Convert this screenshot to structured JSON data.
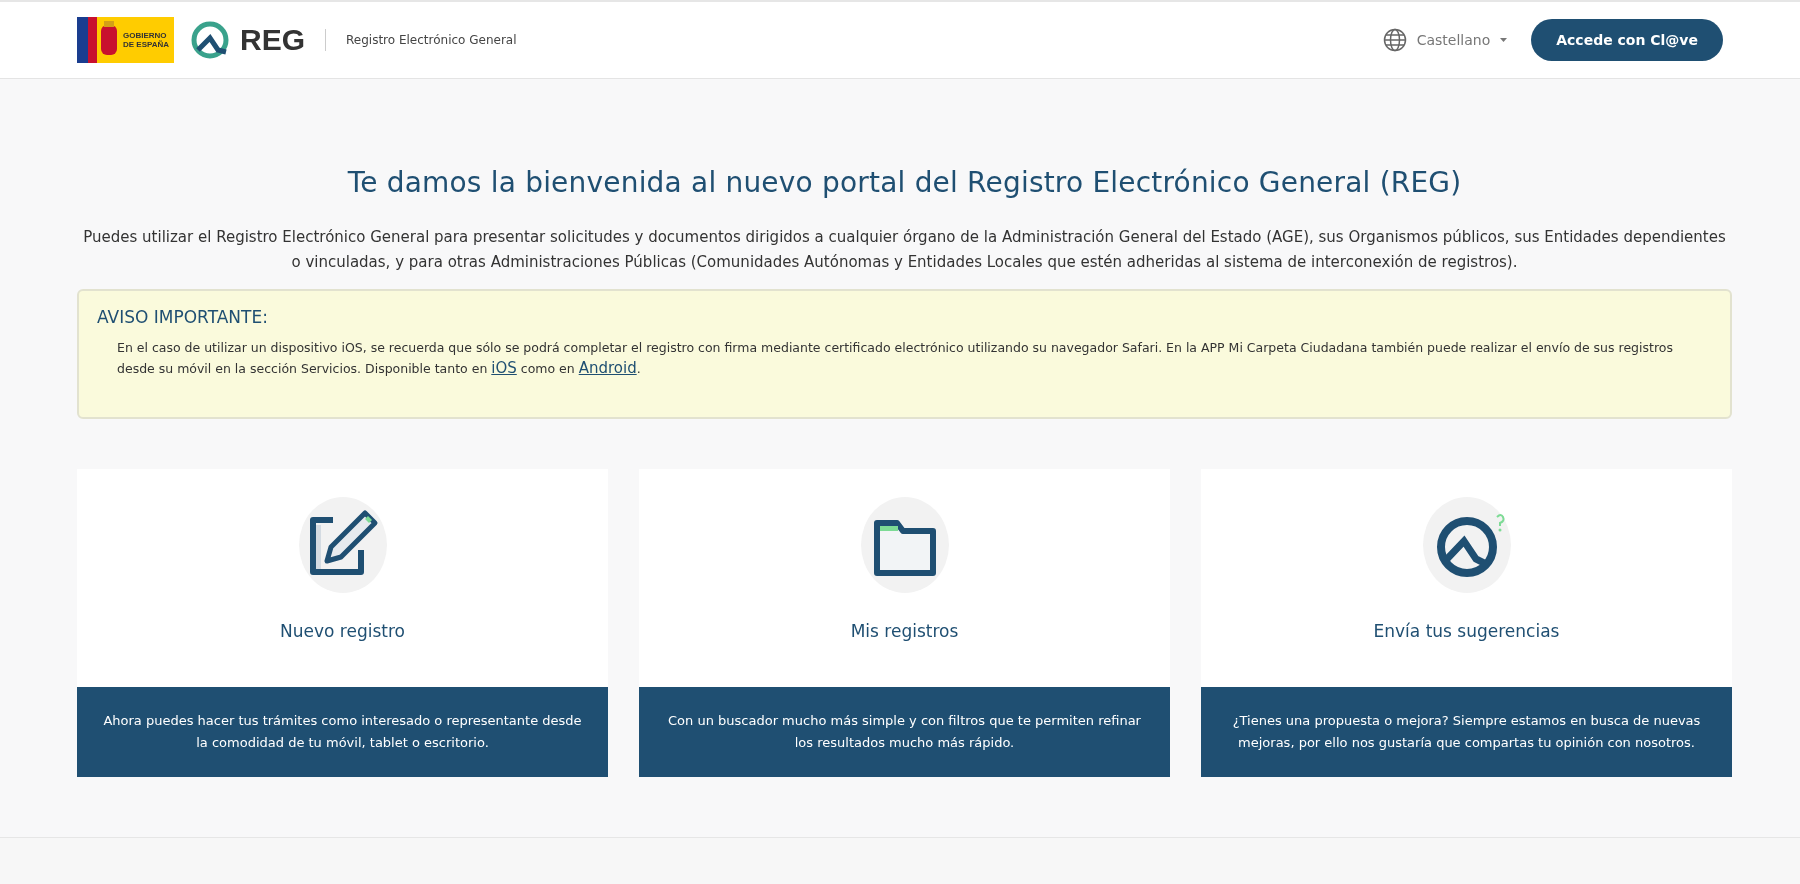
{
  "header": {
    "gov_logo_text": [
      "GOBIERNO",
      "DE ESPAÑA"
    ],
    "brand": "REG",
    "site_name": "Registro Electrónico General",
    "language": "Castellano",
    "login_button": "Accede con Cl@ve"
  },
  "title": "Te damos la bienvenida al nuevo portal del Registro Electrónico General (REG)",
  "intro": "Puedes utilizar el Registro Electrónico General para presentar solicitudes y documentos dirigidos a cualquier órgano de la Administración General del Estado (AGE), sus Organismos públicos, sus Entidades dependientes o vinculadas, y para otras Administraciones Públicas (Comunidades Autónomas y Entidades Locales que estén adheridas al sistema de interconexión de registros).",
  "notice": {
    "heading": "AVISO IMPORTANTE:",
    "body": [
      {
        "kind": "text",
        "text": "En el caso de utilizar un dispositivo iOS, se recuerda que sólo se podrá completar el registro con firma mediante certificado electrónico utilizando su navegador Safari. En la APP Mi Carpeta Ciudadana también puede realizar el envío de sus registros desde su móvil en la sección Servicios. Disponible tanto en "
      },
      {
        "kind": "link",
        "text": "iOS"
      },
      {
        "kind": "text",
        "text": " como en "
      },
      {
        "kind": "link",
        "text": "Android"
      },
      {
        "kind": "text",
        "text": "."
      }
    ]
  },
  "cards": [
    {
      "kind": "edit",
      "title": "Nuevo registro",
      "description": "Ahora puedes hacer tus trámites como interesado o representante desde la comodidad de tu móvil, tablet o escritorio."
    },
    {
      "kind": "folder",
      "title": "Mis registros",
      "description": "Con un buscador mucho más simple y con filtros que te permiten refinar los resultados mucho más rápido."
    },
    {
      "kind": "feedback",
      "title": "Envía tus sugerencias",
      "description": "¿Tienes una propuesta o mejora? Siempre estamos en busca de nuevas mejoras, por ello nos gustaría que compartas tu opinión con nosotros."
    }
  ]
}
